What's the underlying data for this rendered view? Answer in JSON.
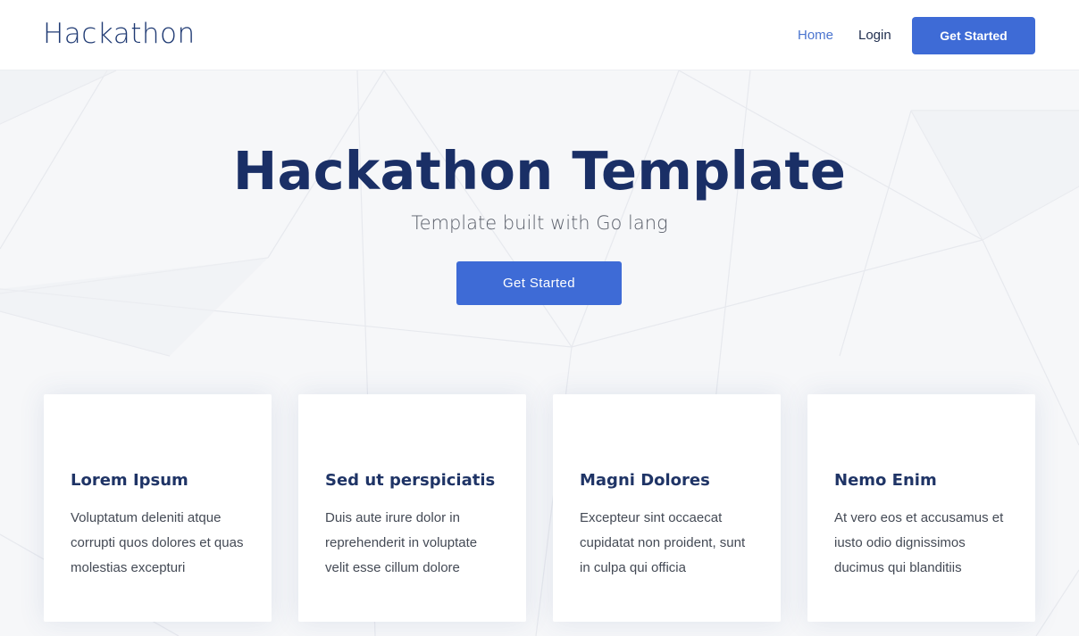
{
  "header": {
    "logo": "Hackathon",
    "nav": {
      "home": "Home",
      "login": "Login",
      "cta": "Get Started"
    }
  },
  "hero": {
    "title": "Hackathon Template",
    "subtitle": "Template built with Go lang",
    "cta": "Get Started"
  },
  "cards": [
    {
      "title": "Lorem Ipsum",
      "text": "Voluptatum deleniti atque corrupti quos dolores et quas molestias excepturi"
    },
    {
      "title": "Sed ut perspiciatis",
      "text": "Duis aute irure dolor in reprehenderit in voluptate velit esse cillum dolore"
    },
    {
      "title": "Magni Dolores",
      "text": "Excepteur sint occaecat cupidatat non proident, sunt in culpa qui officia"
    },
    {
      "title": "Nemo Enim",
      "text": "At vero eos et accusamus et iusto odio dignissimos ducimus qui blanditiis"
    }
  ],
  "colors": {
    "accent": "#3e6bd6",
    "title": "#1a2f66",
    "hero_bg": "#f6f7f9"
  }
}
